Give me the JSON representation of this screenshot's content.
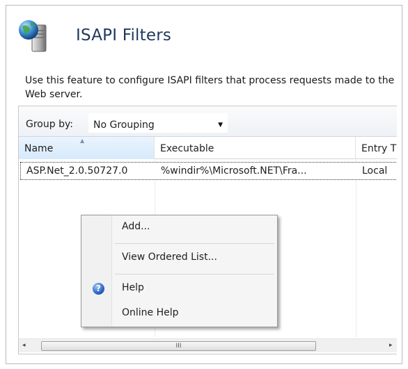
{
  "page": {
    "title": "ISAPI Filters",
    "description": "Use this feature to configure ISAPI filters that process requests made to the Web server.",
    "feature_icon": "globe-server-icon"
  },
  "grouping": {
    "label": "Group by:",
    "selected": "No Grouping"
  },
  "columns": [
    {
      "label": "Name",
      "sorted": true
    },
    {
      "label": "Executable"
    },
    {
      "label": "Entry T"
    }
  ],
  "rows": [
    {
      "name": "ASP.Net_2.0.50727.0",
      "executable": "%windir%\\Microsoft.NET\\Fra...",
      "entry_type": "Local"
    }
  ],
  "context_menu": {
    "items": [
      {
        "label": "Add...",
        "icon": null
      },
      {
        "label": "View Ordered List...",
        "icon": null
      },
      {
        "label": "Help",
        "icon": "help-icon"
      },
      {
        "label": "Online Help",
        "icon": null
      }
    ]
  },
  "scrollbar": {
    "left_arrow": "◂",
    "right_arrow": "▸",
    "grip": "III"
  }
}
